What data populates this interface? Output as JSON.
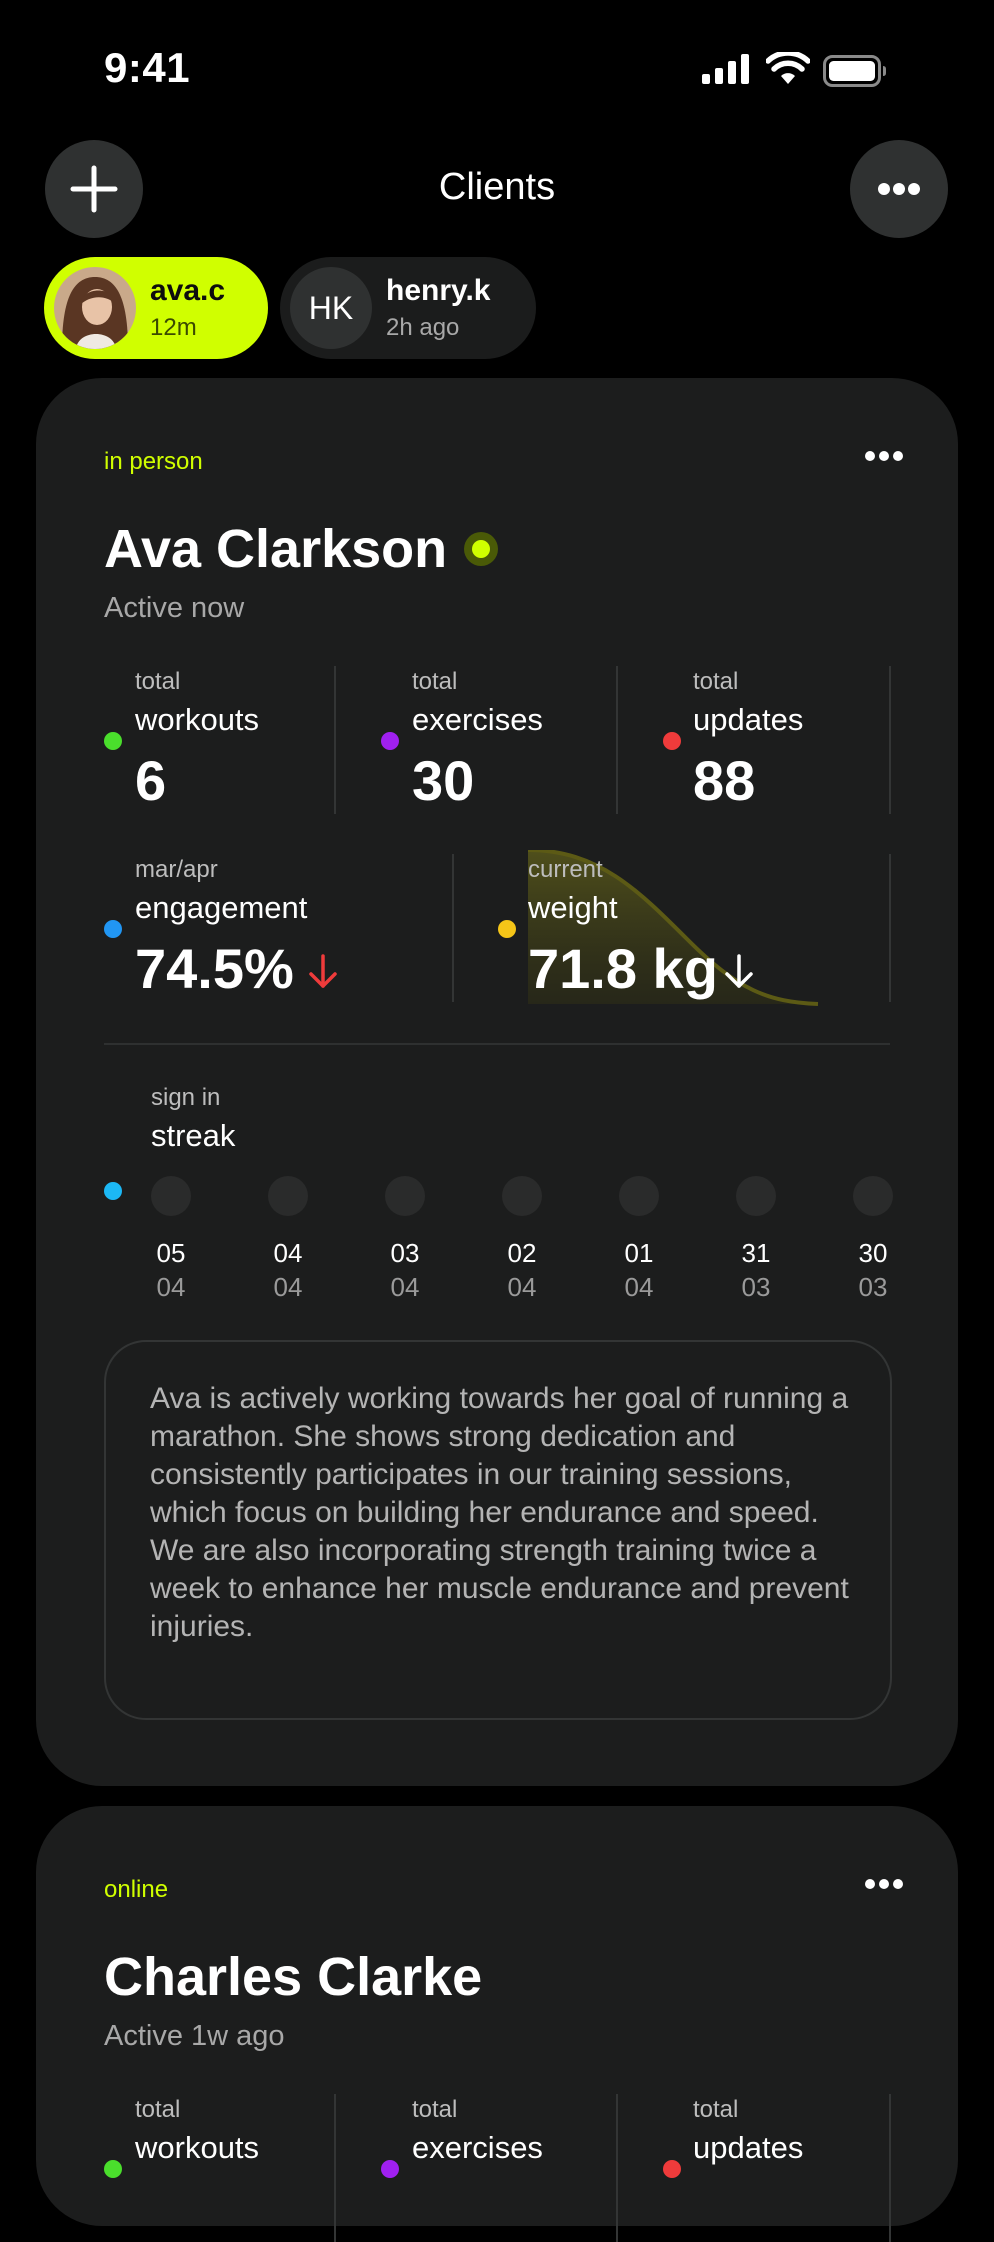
{
  "status_bar": {
    "time": "9:41",
    "icons": [
      "signal-icon",
      "wifi-icon",
      "battery-icon"
    ]
  },
  "header": {
    "title": "Clients",
    "left_icon": "plus-icon",
    "right_icon": "more-horizontal-icon"
  },
  "clients": [
    {
      "name": "ava.c",
      "time": "12m",
      "active": true,
      "avatar": "photo"
    },
    {
      "name": "henry.k",
      "time": "2h ago",
      "active": false,
      "initials": "HK"
    }
  ],
  "cards": [
    {
      "tag": "in person",
      "name": "Ava Clarkson",
      "status": "Active now",
      "stats": [
        {
          "small": "total",
          "label": "workouts",
          "value": "6",
          "color": "#4ade2c"
        },
        {
          "small": "total",
          "label": "exercises",
          "value": "30",
          "color": "#a020f0"
        },
        {
          "small": "total",
          "label": "updates",
          "value": "88",
          "color": "#ef3b3b"
        }
      ],
      "engagement": {
        "small": "mar/apr",
        "label": "engagement",
        "value": "74.5%",
        "trend": "down",
        "color": "#2196f3"
      },
      "weight": {
        "small": "current",
        "label": "weight",
        "value": "71.8 kg",
        "trend": "down",
        "color": "#f5c518"
      },
      "streak": {
        "small": "sign in",
        "label": "streak",
        "color": "#1cb8f5",
        "days": [
          {
            "day": "05",
            "month": "04"
          },
          {
            "day": "04",
            "month": "04"
          },
          {
            "day": "03",
            "month": "04"
          },
          {
            "day": "02",
            "month": "04"
          },
          {
            "day": "01",
            "month": "04"
          },
          {
            "day": "31",
            "month": "03"
          },
          {
            "day": "30",
            "month": "03"
          }
        ]
      },
      "notes": "Ava is actively working towards her goal of running a marathon. She shows strong dedication and consistently participates in our training sessions, which focus on building her endurance and speed. We are also incorporating strength training twice a week to enhance her muscle endurance and prevent injuries."
    },
    {
      "tag": "online",
      "name": "Charles Clarke",
      "status": "Active 1w ago",
      "stats": [
        {
          "small": "total",
          "label": "workouts",
          "color": "#4ade2c"
        },
        {
          "small": "total",
          "label": "exercises",
          "color": "#a020f0"
        },
        {
          "small": "total",
          "label": "updates",
          "color": "#ef3b3b"
        }
      ]
    }
  ],
  "colors": {
    "accent": "#d0ff00",
    "background": "#000000",
    "card": "#1c1d1d",
    "down_red": "#ef3b3b"
  }
}
